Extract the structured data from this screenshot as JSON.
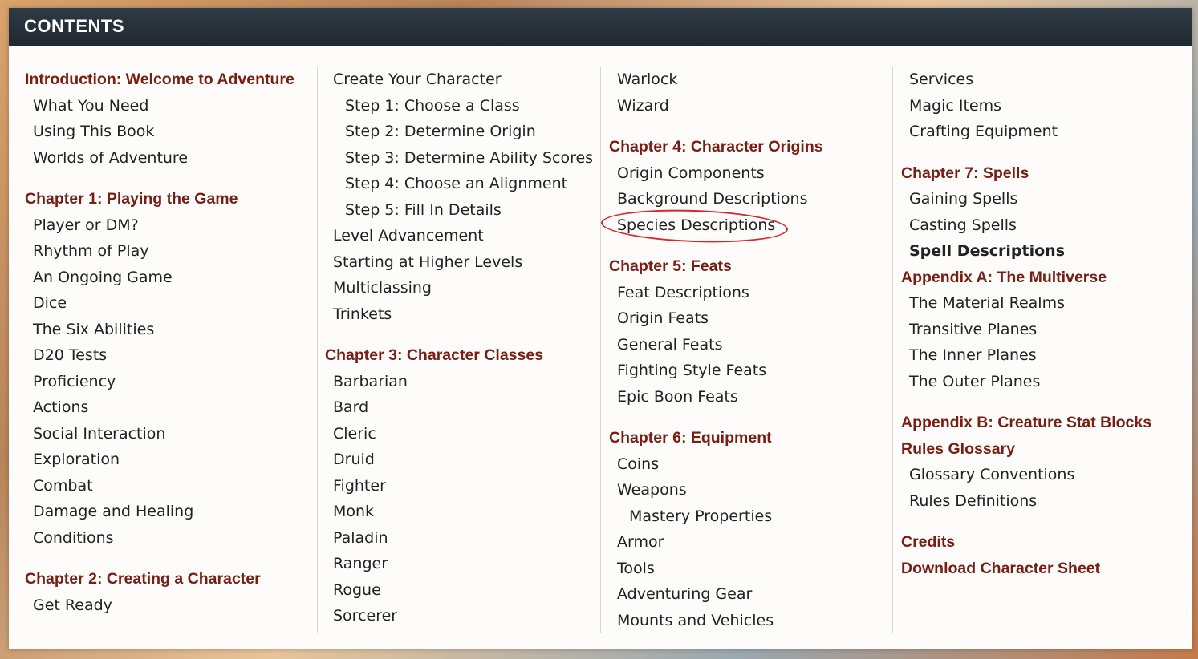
{
  "header": {
    "title": "CONTENTS"
  },
  "annotation": {
    "color": "#d8262a"
  },
  "columns": [
    [
      {
        "label": "Introduction: Welcome to Adventure",
        "type": "chapter"
      },
      {
        "label": "What You Need",
        "level": 1
      },
      {
        "label": "Using This Book",
        "level": 1
      },
      {
        "label": "Worlds of Adventure",
        "level": 1
      },
      {
        "label": "Chapter 1: Playing the Game",
        "type": "chapter"
      },
      {
        "label": "Player or DM?",
        "level": 1
      },
      {
        "label": "Rhythm of Play",
        "level": 1
      },
      {
        "label": "An Ongoing Game",
        "level": 1
      },
      {
        "label": "Dice",
        "level": 1
      },
      {
        "label": "The Six Abilities",
        "level": 1
      },
      {
        "label": "D20 Tests",
        "level": 1
      },
      {
        "label": "Proficiency",
        "level": 1
      },
      {
        "label": "Actions",
        "level": 1
      },
      {
        "label": "Social Interaction",
        "level": 1
      },
      {
        "label": "Exploration",
        "level": 1
      },
      {
        "label": "Combat",
        "level": 1
      },
      {
        "label": "Damage and Healing",
        "level": 1
      },
      {
        "label": "Conditions",
        "level": 1
      },
      {
        "label": "Chapter 2: Creating a Character",
        "type": "chapter"
      },
      {
        "label": "Get Ready",
        "level": 1
      }
    ],
    [
      {
        "label": "Create Your Character",
        "level": 1
      },
      {
        "label": "Step 1: Choose a Class",
        "level": 2
      },
      {
        "label": "Step 2: Determine Origin",
        "level": 2
      },
      {
        "label": "Step 3: Determine Ability Scores",
        "level": 2
      },
      {
        "label": "Step 4: Choose an Alignment",
        "level": 2
      },
      {
        "label": "Step 5: Fill In Details",
        "level": 2
      },
      {
        "label": "Level Advancement",
        "level": 1
      },
      {
        "label": "Starting at Higher Levels",
        "level": 1
      },
      {
        "label": "Multiclassing",
        "level": 1
      },
      {
        "label": "Trinkets",
        "level": 1
      },
      {
        "label": "Chapter 3: Character Classes",
        "type": "chapter"
      },
      {
        "label": "Barbarian",
        "level": 1
      },
      {
        "label": "Bard",
        "level": 1
      },
      {
        "label": "Cleric",
        "level": 1
      },
      {
        "label": "Druid",
        "level": 1
      },
      {
        "label": "Fighter",
        "level": 1
      },
      {
        "label": "Monk",
        "level": 1
      },
      {
        "label": "Paladin",
        "level": 1
      },
      {
        "label": "Ranger",
        "level": 1
      },
      {
        "label": "Rogue",
        "level": 1
      },
      {
        "label": "Sorcerer",
        "level": 1
      }
    ],
    [
      {
        "label": "Warlock",
        "level": 1
      },
      {
        "label": "Wizard",
        "level": 1
      },
      {
        "label": "Chapter 4: Character Origins",
        "type": "chapter"
      },
      {
        "label": "Origin Components",
        "level": 1
      },
      {
        "label": "Background Descriptions",
        "level": 1
      },
      {
        "label": "Species Descriptions",
        "level": 1,
        "circled": true
      },
      {
        "label": "Chapter 5: Feats",
        "type": "chapter"
      },
      {
        "label": "Feat Descriptions",
        "level": 1
      },
      {
        "label": "Origin Feats",
        "level": 1
      },
      {
        "label": "General Feats",
        "level": 1
      },
      {
        "label": "Fighting Style Feats",
        "level": 1
      },
      {
        "label": "Epic Boon Feats",
        "level": 1
      },
      {
        "label": "Chapter 6: Equipment",
        "type": "chapter"
      },
      {
        "label": "Coins",
        "level": 1
      },
      {
        "label": "Weapons",
        "level": 1
      },
      {
        "label": "Mastery Properties",
        "level": 2
      },
      {
        "label": "Armor",
        "level": 1
      },
      {
        "label": "Tools",
        "level": 1
      },
      {
        "label": "Adventuring Gear",
        "level": 1
      },
      {
        "label": "Mounts and Vehicles",
        "level": 1
      }
    ],
    [
      {
        "label": "Services",
        "level": 1
      },
      {
        "label": "Magic Items",
        "level": 1
      },
      {
        "label": "Crafting Equipment",
        "level": 1
      },
      {
        "label": "Chapter 7: Spells",
        "type": "chapter"
      },
      {
        "label": "Gaining Spells",
        "level": 1
      },
      {
        "label": "Casting Spells",
        "level": 1
      },
      {
        "label": "Spell Descriptions",
        "level": 1,
        "bold": true
      },
      {
        "label": "Appendix A: The Multiverse",
        "type": "chapter",
        "nogap": true
      },
      {
        "label": "The Material Realms",
        "level": 1
      },
      {
        "label": "Transitive Planes",
        "level": 1
      },
      {
        "label": "The Inner Planes",
        "level": 1
      },
      {
        "label": "The Outer Planes",
        "level": 1
      },
      {
        "label": "Appendix B: Creature Stat Blocks",
        "type": "chapter"
      },
      {
        "label": "Rules Glossary",
        "type": "chapter",
        "nogap": true
      },
      {
        "label": "Glossary Conventions",
        "level": 1
      },
      {
        "label": "Rules Definitions",
        "level": 1
      },
      {
        "label": "Credits",
        "type": "chapter"
      },
      {
        "label": "Download Character Sheet",
        "type": "chapter",
        "nogap": true
      }
    ]
  ]
}
